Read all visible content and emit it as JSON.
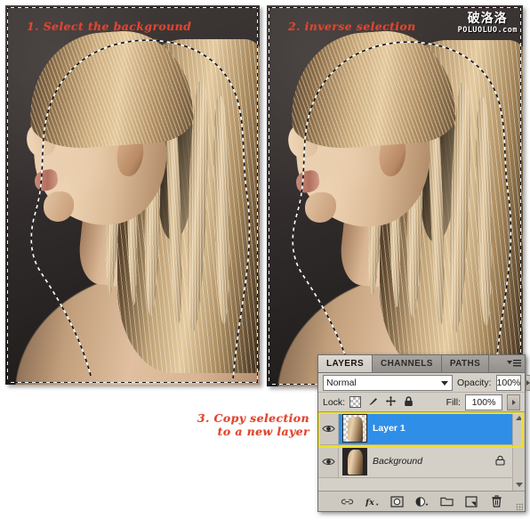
{
  "tutorial": {
    "annotations": [
      {
        "name": "step-1",
        "text": "1. Select the background"
      },
      {
        "name": "step-2",
        "text": "2. inverse selection"
      },
      {
        "name": "step-3",
        "text": "3. Copy selection\n     to a new layer"
      }
    ],
    "annotation_color": "#e0452f",
    "highlight_color": "#f2e21a"
  },
  "watermark": {
    "chinese": "破洛洛",
    "latin": "POLUOLUO.com"
  },
  "layers_panel": {
    "tabs": [
      {
        "label": "LAYERS",
        "active": true
      },
      {
        "label": "CHANNELS",
        "active": false
      },
      {
        "label": "PATHS",
        "active": false
      }
    ],
    "panel_menu_icon": "panel-menu-icon",
    "blend_mode": "Normal",
    "opacity_label": "Opacity:",
    "opacity_value": "100%",
    "lock_label": "Lock:",
    "lock_icons": [
      "lock-transparency-icon",
      "lock-pixels-icon",
      "lock-position-icon",
      "lock-all-icon"
    ],
    "fill_label": "Fill:",
    "fill_value": "100%",
    "layers": [
      {
        "name": "Layer 1",
        "visible": true,
        "selected": true,
        "locked": false,
        "thumbnail": "cutout-transparent-thumbnail"
      },
      {
        "name": "Background",
        "visible": true,
        "selected": false,
        "locked": true,
        "thumbnail": "photo-thumbnail"
      }
    ],
    "selection_color": "#2f8fe8",
    "bottom_buttons": [
      "link-layers-icon",
      "layer-style-fx-icon",
      "add-layer-mask-icon",
      "new-adjustment-layer-icon",
      "new-group-icon",
      "new-layer-icon",
      "delete-layer-icon"
    ]
  },
  "canvases": [
    {
      "name": "canvas-step-1",
      "selection": "background-selected"
    },
    {
      "name": "canvas-step-2",
      "selection": "subject-selected"
    }
  ]
}
